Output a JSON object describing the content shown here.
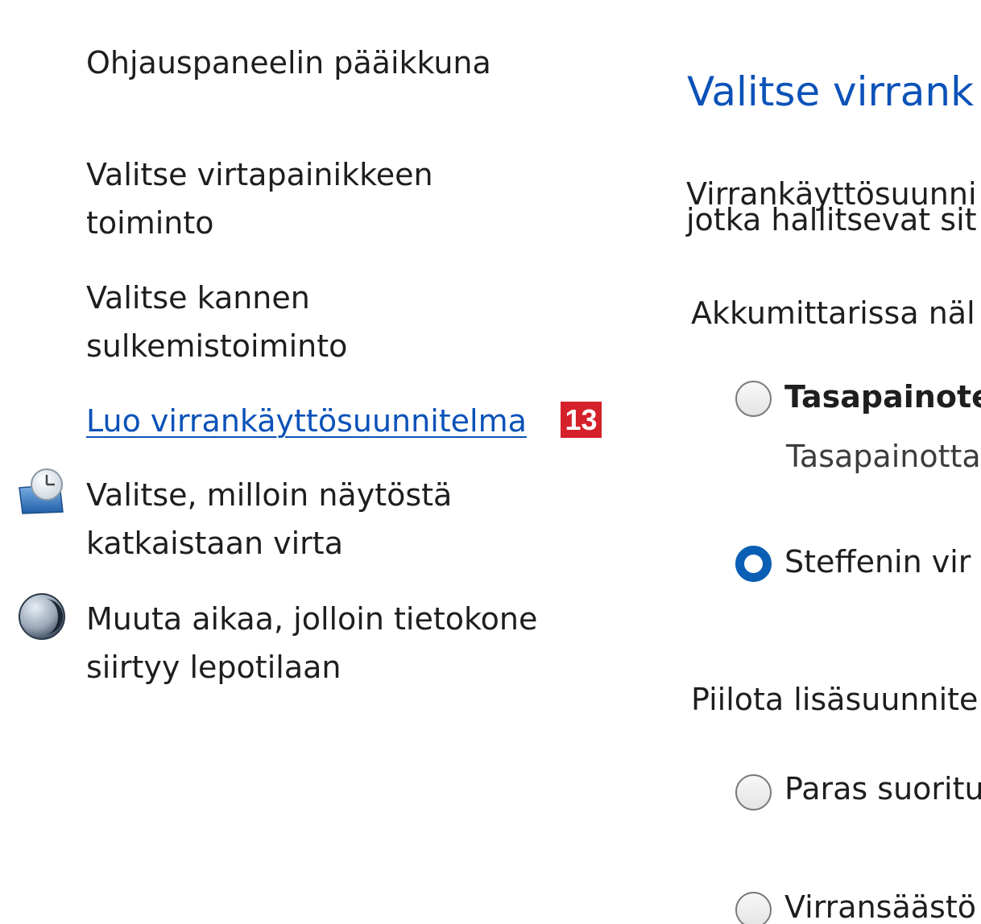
{
  "sidebar": {
    "home_link": "Ohjauspaneelin pääikkuna",
    "links": [
      {
        "line1": "Valitse virtapainikkeen",
        "line2": "toiminto"
      },
      {
        "line1": "Valitse kannen",
        "line2": "sulkemistoiminto"
      }
    ],
    "create_plan_link": "Luo virrankäyttösuunnitelma",
    "badge": "13",
    "icon_links": [
      {
        "icon": "display-clock-icon",
        "line1": "Valitse, milloin näytöstä",
        "line2": "katkaistaan virta"
      },
      {
        "icon": "moon-sleep-icon",
        "line1": "Muuta aikaa, jolloin tietokone",
        "line2": "siirtyy lepotilaan"
      }
    ]
  },
  "main": {
    "title": "Valitse virrank",
    "description_line1": "Virrankäyttösuunni",
    "description_line2": "jotka hallitsevat sit",
    "battery_section_label": "Akkumittarissa näl",
    "plans": [
      {
        "label": "Tasapainote",
        "description": "Tasapainotta",
        "selected": false
      },
      {
        "label": "Steffenin vir",
        "selected": true
      }
    ],
    "hidden_section_label": "Piilota lisäsuunnite",
    "hidden_plans": [
      {
        "label": "Paras suoritu",
        "selected": false
      },
      {
        "label": "Virransäästö",
        "selected": false
      }
    ]
  },
  "colors": {
    "link_blue": "#0b52b8",
    "title_blue": "#0b52b8",
    "radio_selected": "#0a5fb4",
    "badge_red": "#d4212a",
    "text": "#1e1e1e"
  }
}
